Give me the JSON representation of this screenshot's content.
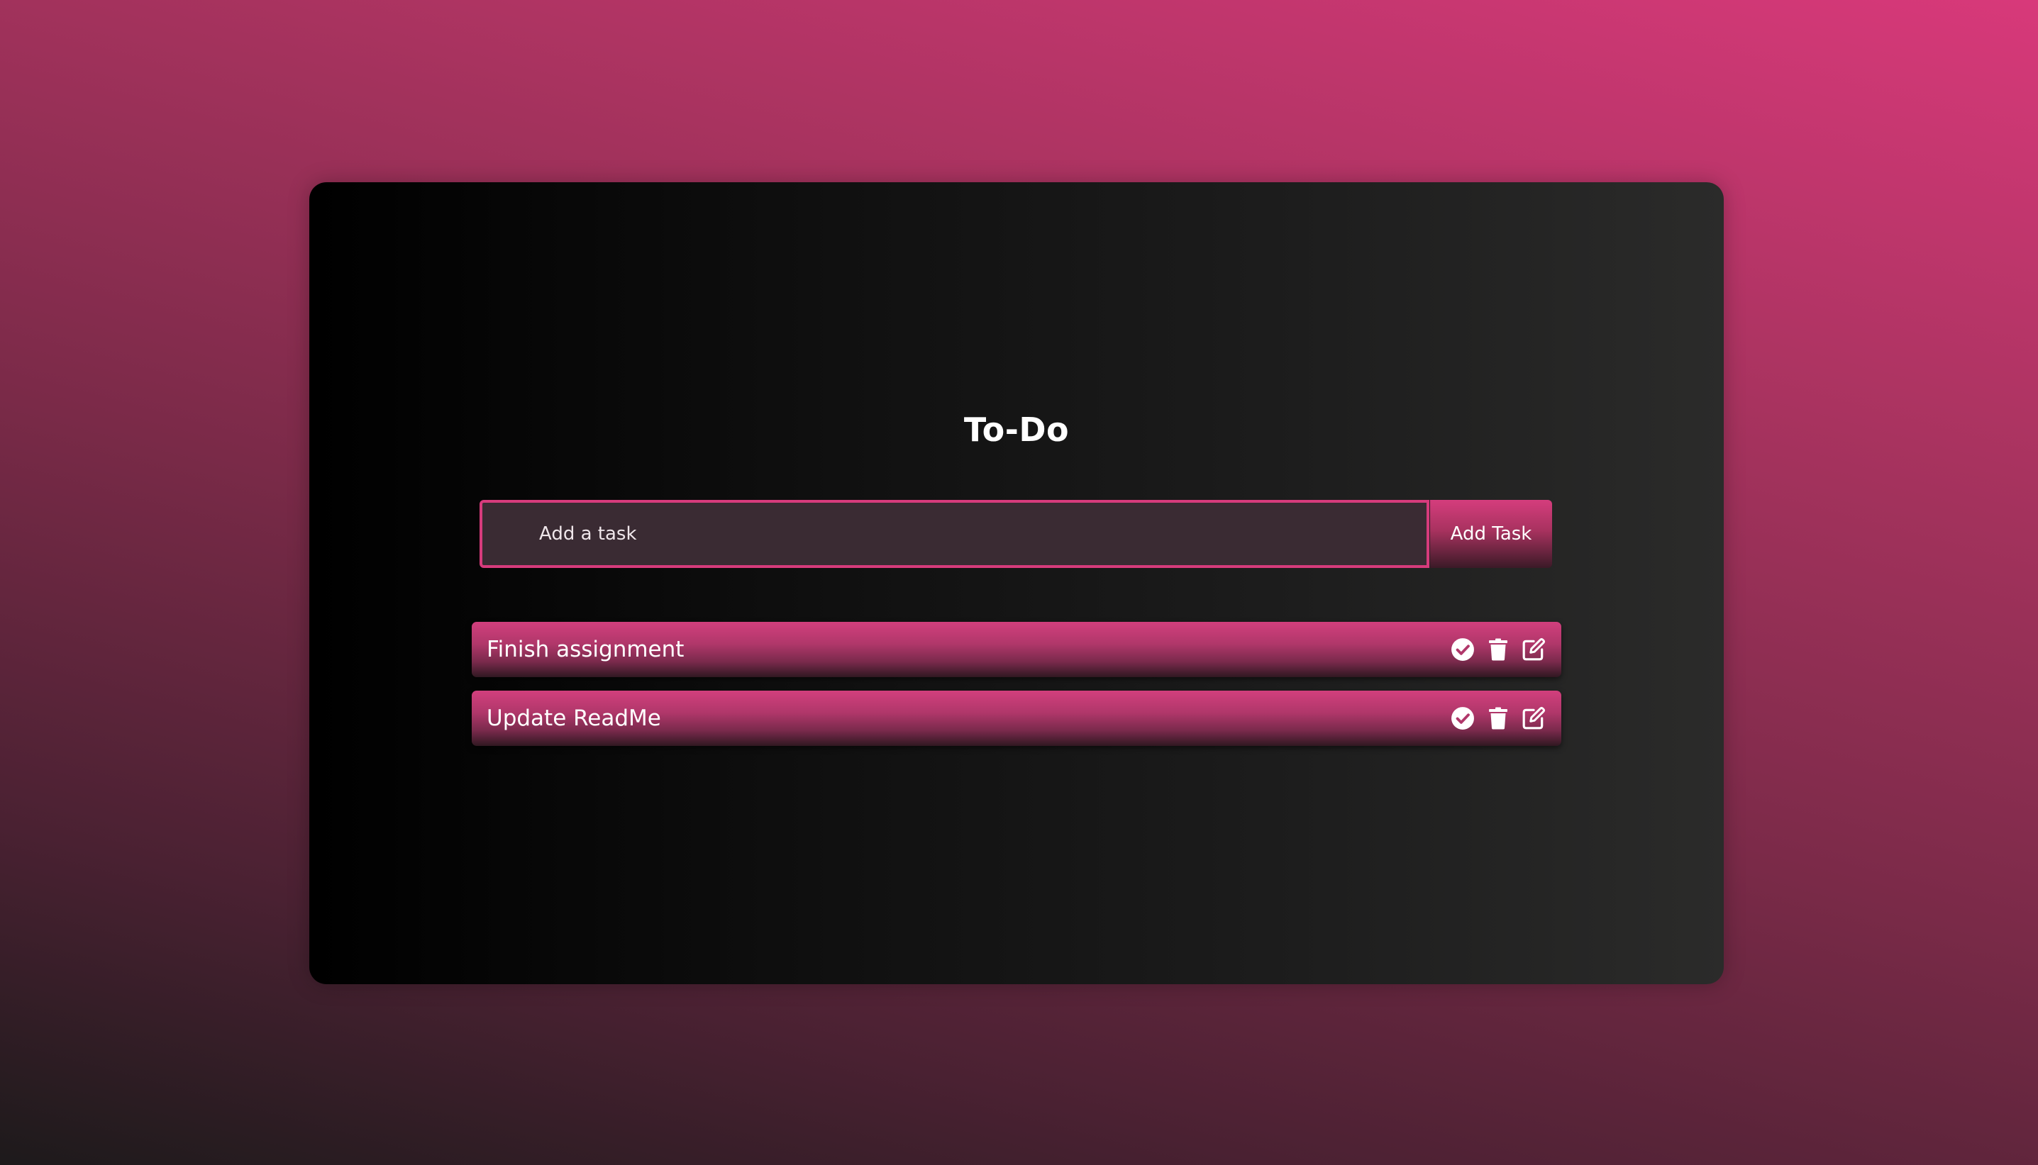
{
  "app": {
    "title": "To-Do"
  },
  "input": {
    "placeholder": "Add a task",
    "value": ""
  },
  "add_button": {
    "label": "Add Task"
  },
  "tasks": [
    {
      "text": "Finish assignment",
      "actions": [
        "check-circle-icon",
        "trash-icon",
        "edit-icon"
      ]
    },
    {
      "text": "Update ReadMe",
      "actions": [
        "check-circle-icon",
        "trash-icon",
        "edit-icon"
      ]
    }
  ],
  "colors": {
    "accent": "#d63b7c",
    "card_dark": "#000000",
    "card_light": "#2b2b2a",
    "input_bg": "#3a2b33",
    "text": "#ffffff"
  }
}
